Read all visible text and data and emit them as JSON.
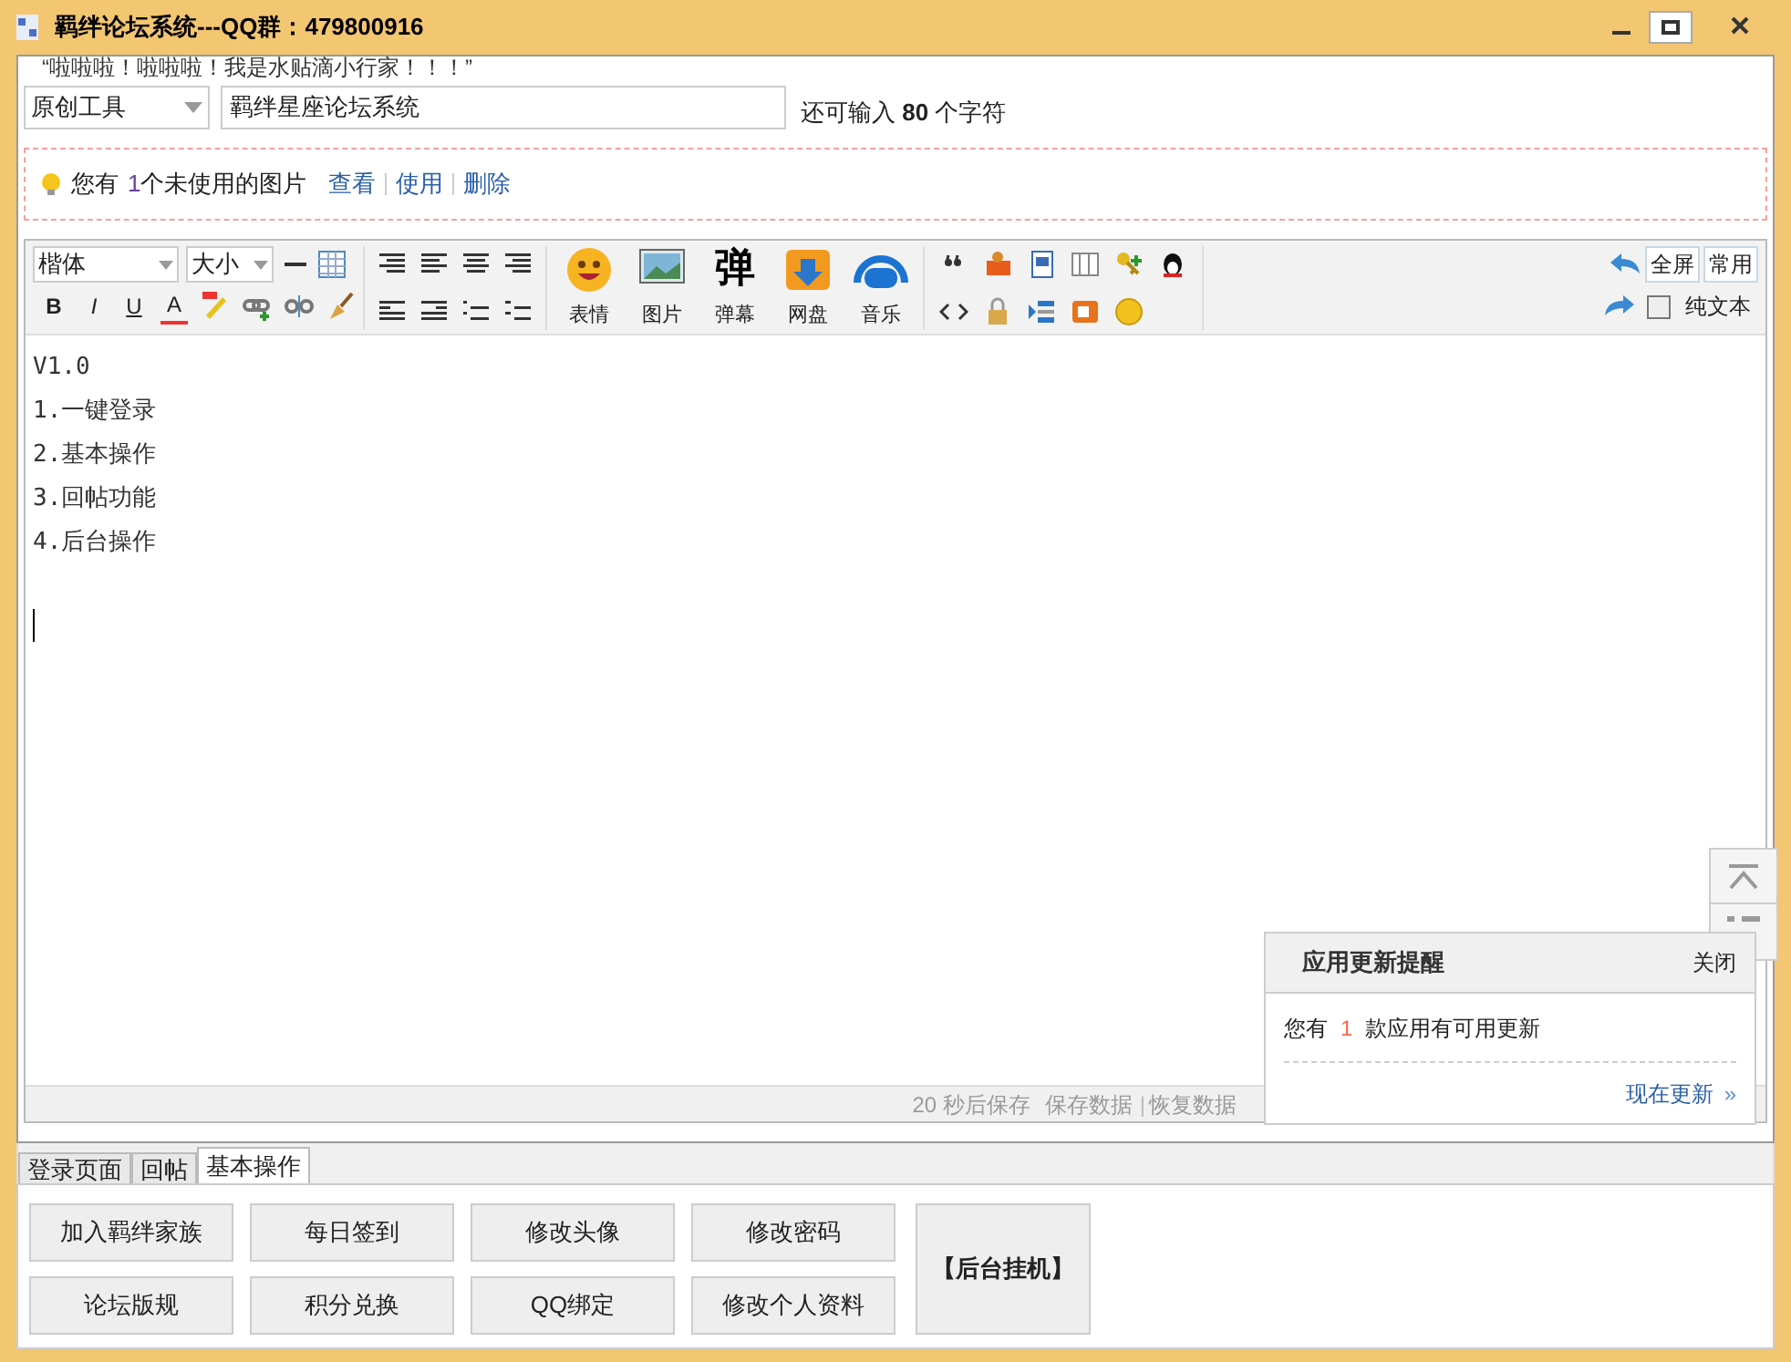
{
  "window": {
    "title": "羁绊论坛系统---QQ群：479800916"
  },
  "quote": "“啦啦啦！啦啦啦！我是水贴滴小行家！！！”",
  "post": {
    "category": "原创工具",
    "title_value": "羁绊星座论坛系统",
    "remaining": "还可输入 **80** 个字符"
  },
  "attachments": {
    "prefix": "您有",
    "count": "1",
    "suffix": "个未使用的图片",
    "links": [
      "查看",
      "使用",
      "删除"
    ]
  },
  "toolbar": {
    "font": "楷体",
    "size": "大小",
    "format": [
      "B",
      "I",
      "U",
      "A"
    ],
    "media": [
      {
        "kind": "emoji",
        "label": "表情"
      },
      {
        "kind": "image",
        "label": "图片"
      },
      {
        "kind": "glyph",
        "glyph": "弹",
        "label": "弹幕"
      },
      {
        "kind": "disk",
        "label": "网盘"
      },
      {
        "kind": "music",
        "label": "音乐"
      }
    ],
    "buttons": [
      "全屏",
      "常用"
    ],
    "plain_text": {
      "label": "纯文本",
      "checked": false
    }
  },
  "editor": {
    "lines": [
      "V1.0",
      "1.一键登录",
      "2.基本操作",
      "3.回帖功能",
      "4.后台操作"
    ]
  },
  "status": {
    "timer": "20 秒后保存",
    "save": "保存数据",
    "separator": "|",
    "restore": "恢复数据"
  },
  "popup": {
    "title": "应用更新提醒",
    "close": "关闭",
    "prefix": "您有",
    "count": "1",
    "suffix": "款应用有可用更新",
    "action": "现在更新",
    "action_icon": "»"
  },
  "tabs": [
    {
      "label": "登录页面",
      "selected": false
    },
    {
      "label": "回帖",
      "selected": false
    },
    {
      "label": "基本操作",
      "selected": true
    }
  ],
  "actions": [
    {
      "label": "加入羁绊家族"
    },
    {
      "label": "每日签到"
    },
    {
      "label": "修改头像"
    },
    {
      "label": "修改密码"
    },
    {
      "label": "论坛版规"
    },
    {
      "label": "积分兑换"
    },
    {
      "label": "QQ绑定"
    },
    {
      "label": "修改个人资料"
    }
  ],
  "side_action": "【后台挂机】"
}
